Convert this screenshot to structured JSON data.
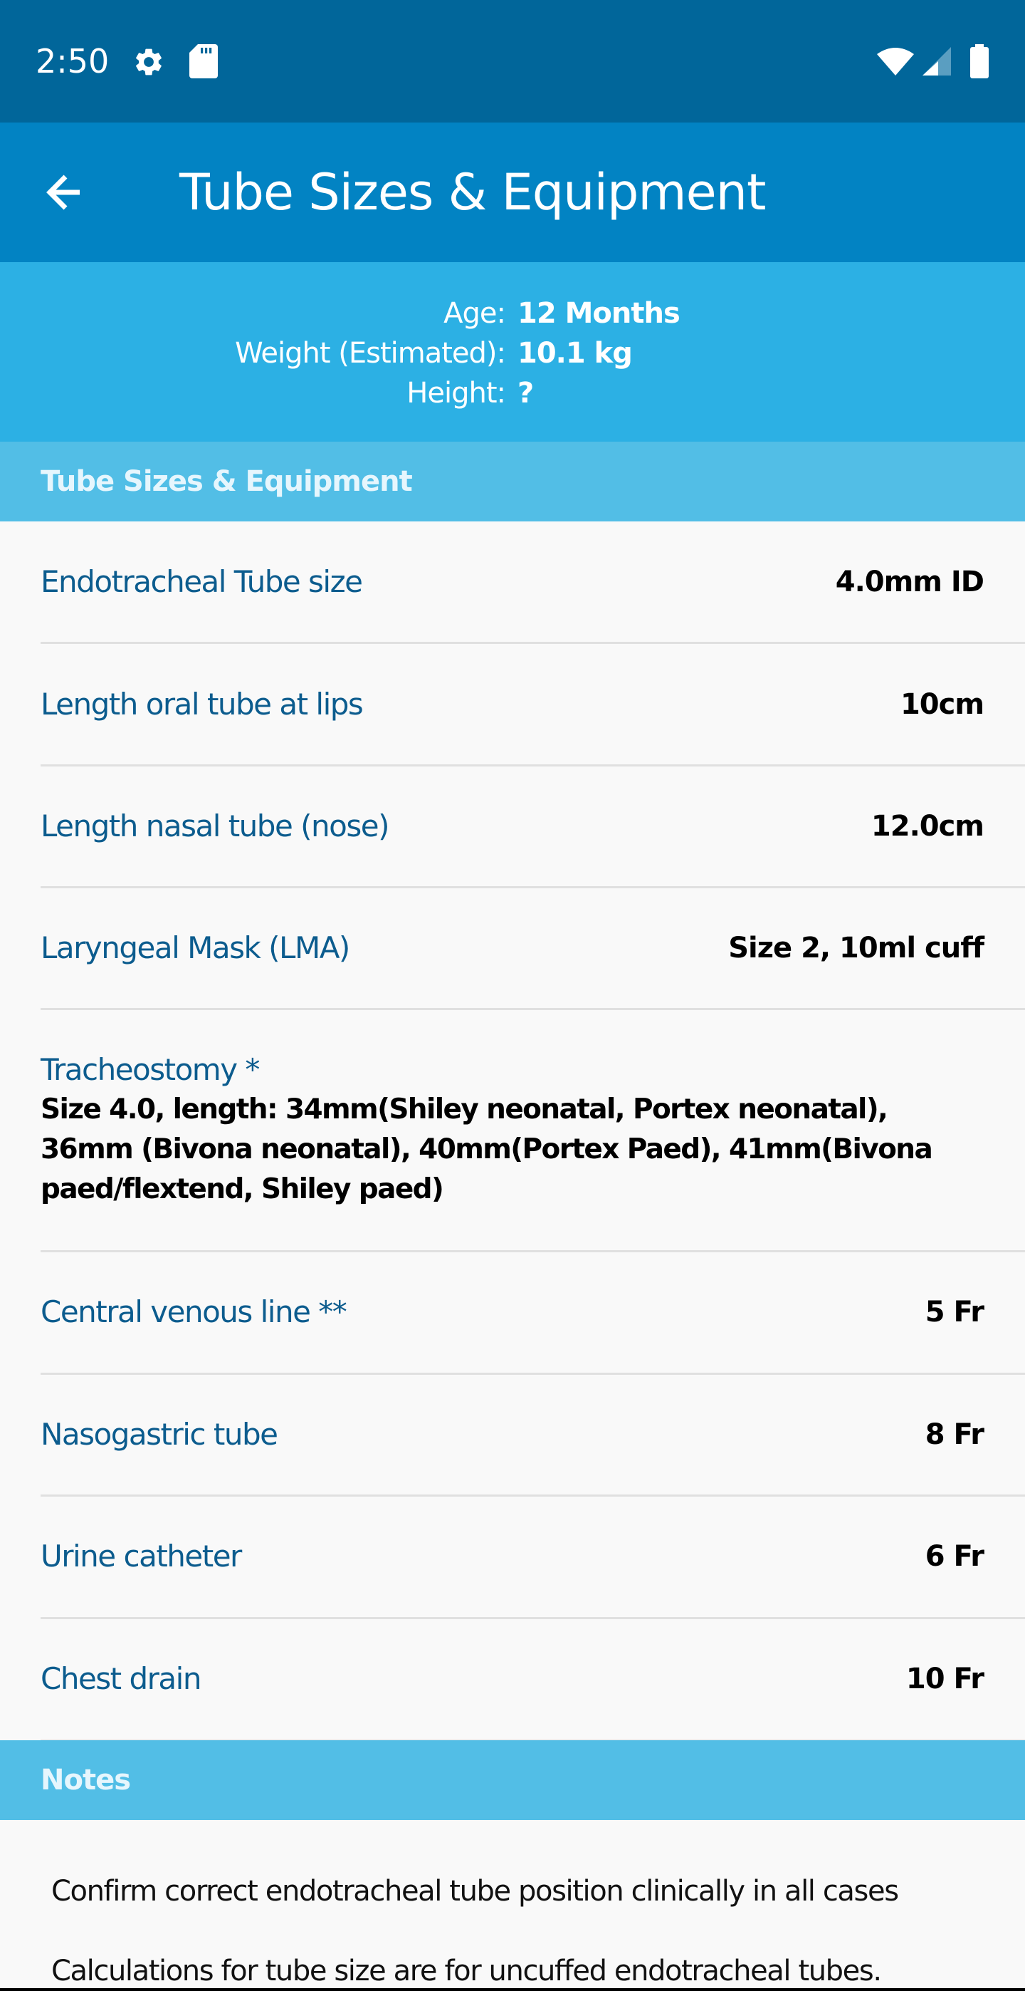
{
  "status_bar": {
    "time": "2:50",
    "left_icons": [
      "gear-icon",
      "sd-card-icon"
    ],
    "right_icons": [
      "wifi-icon",
      "cellular-signal-icon",
      "battery-icon"
    ]
  },
  "app_bar": {
    "back_icon": "arrow-back-icon",
    "title": "Tube Sizes & Equipment"
  },
  "patient_info": [
    {
      "label": "Age:",
      "value": "12 Months"
    },
    {
      "label": "Weight (Estimated):",
      "value": "10.1 kg"
    },
    {
      "label": "Height:",
      "value": "?"
    }
  ],
  "section": {
    "title": "Tube Sizes & Equipment",
    "rows": [
      {
        "label": "Endotracheal Tube size",
        "value": "4.0mm ID"
      },
      {
        "label": "Length oral tube at lips",
        "value": "10cm"
      },
      {
        "label": "Length nasal tube (nose)",
        "value": "12.0cm"
      },
      {
        "label": "Laryngeal Mask (LMA)",
        "value": "Size 2, 10ml cuff"
      },
      {
        "label": "Tracheostomy *",
        "value": "Size 4.0, length: 34mm(Shiley neonatal, Portex neonatal), 36mm (Bivona neonatal), 40mm(Portex Paed), 41mm(Bivona paed/flextend, Shiley paed)"
      },
      {
        "label": "Central venous line **",
        "value": "5 Fr"
      },
      {
        "label": "Nasogastric tube",
        "value": "8 Fr"
      },
      {
        "label": "Urine catheter",
        "value": "6 Fr"
      },
      {
        "label": "Chest drain",
        "value": "10 Fr"
      }
    ]
  },
  "notes": {
    "title": "Notes",
    "items": [
      "Confirm correct endotracheal tube position clinically in all cases",
      "Calculations for tube size are for uncuffed endotracheal tubes."
    ]
  },
  "colors": {
    "status_bar": "#01669a",
    "app_bar": "#0283c3",
    "info_panel": "#2cb0e4",
    "section_header": "#52bee6",
    "label_text": "#0c5c8e",
    "background": "#f9f9f9"
  }
}
